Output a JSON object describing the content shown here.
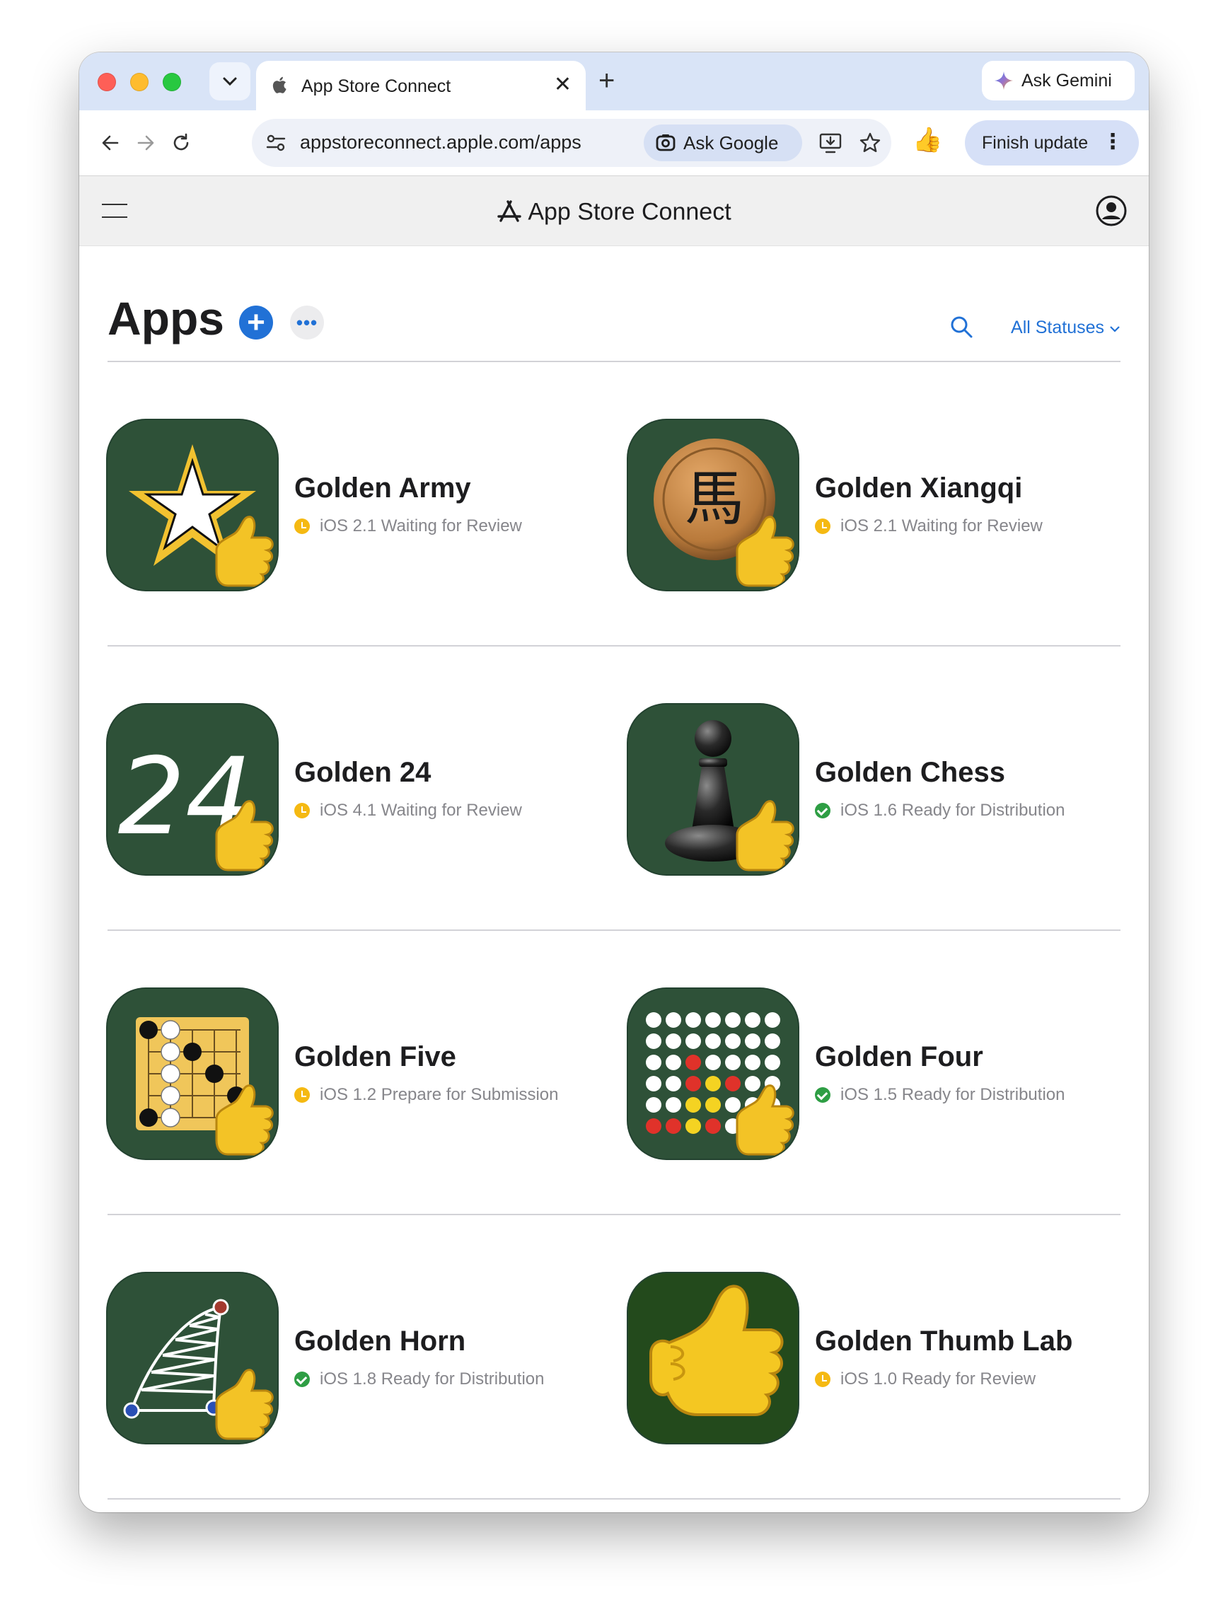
{
  "browser": {
    "tab_title": "App Store Connect",
    "new_tab_label": "+",
    "ask_gemini_label": "Ask Gemini",
    "url": "appstoreconnect.apple.com/apps",
    "ask_google_label": "Ask Google",
    "finish_update_label": "Finish update"
  },
  "header": {
    "title": "App Store Connect"
  },
  "apps_page": {
    "title": "Apps",
    "status_filter": "All Statuses"
  },
  "apps": [
    {
      "name": "Golden Army",
      "status": "iOS 2.1 Waiting for Review",
      "state": "waiting",
      "icon": "star-icon"
    },
    {
      "name": "Golden Xiangqi",
      "status": "iOS 2.1 Waiting for Review",
      "state": "waiting",
      "icon": "xiangqi-horse-icon"
    },
    {
      "name": "Golden 24",
      "status": "iOS 4.1 Waiting for Review",
      "state": "waiting",
      "icon": "number-24-icon"
    },
    {
      "name": "Golden Chess",
      "status": "iOS 1.6 Ready for Distribution",
      "state": "ready",
      "icon": "chess-pawn-icon"
    },
    {
      "name": "Golden Five",
      "status": "iOS 1.2 Prepare for Submission",
      "state": "waiting",
      "icon": "gomoku-board-icon"
    },
    {
      "name": "Golden Four",
      "status": "iOS 1.5 Ready for Distribution",
      "state": "ready",
      "icon": "connect-four-icon"
    },
    {
      "name": "Golden Horn",
      "status": "iOS 1.8 Ready for Distribution",
      "state": "ready",
      "icon": "horn-truss-icon"
    },
    {
      "name": "Golden Thumb Lab",
      "status": "iOS 1.0 Ready for Review",
      "state": "waiting",
      "icon": "thumbs-up-icon"
    }
  ],
  "icon_glyphs": {
    "xiangqi_char": "馬",
    "number_24": "24",
    "thumbs_emoji": "👍"
  },
  "colors": {
    "accent": "#2171d6",
    "icon_green": "#2e5138",
    "waiting_yellow": "#f5b912",
    "ready_green": "#2e9e44"
  }
}
